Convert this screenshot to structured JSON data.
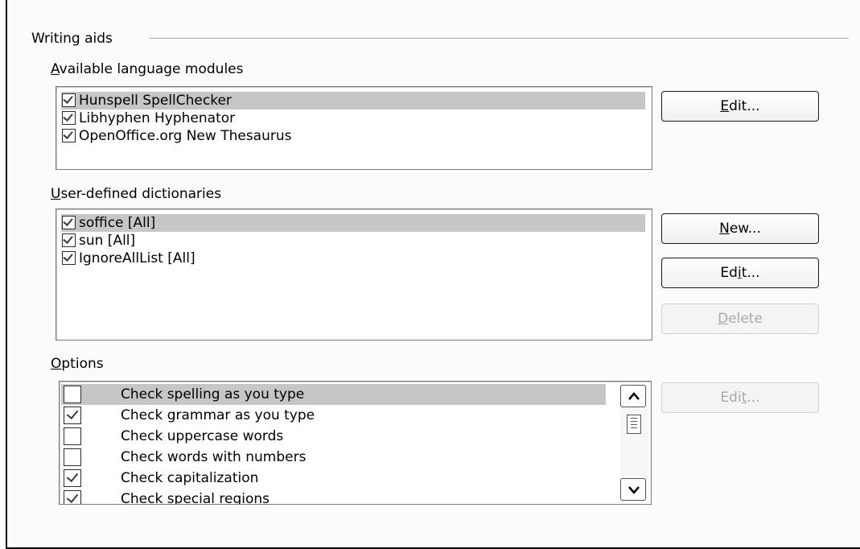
{
  "group": {
    "title": "Writing aids"
  },
  "modules": {
    "label": "Available language modules",
    "items": [
      {
        "label": "Hunspell SpellChecker",
        "checked": true,
        "selected": true
      },
      {
        "label": "Libhyphen Hyphenator",
        "checked": true,
        "selected": false
      },
      {
        "label": "OpenOffice.org New Thesaurus",
        "checked": true,
        "selected": false
      }
    ],
    "edit_label": "Edit..."
  },
  "dictionaries": {
    "label": "User-defined dictionaries",
    "items": [
      {
        "label": "soffice [All]",
        "checked": true,
        "selected": true
      },
      {
        "label": "sun [All]",
        "checked": true,
        "selected": false
      },
      {
        "label": "IgnoreAllList [All]",
        "checked": true,
        "selected": false
      }
    ],
    "new_label": "New...",
    "edit_label": "Edit...",
    "delete_label": "Delete"
  },
  "options": {
    "label": "Options",
    "items": [
      {
        "label": "Check spelling as you type",
        "checked": false,
        "selected": true
      },
      {
        "label": "Check grammar as you type",
        "checked": true,
        "selected": false
      },
      {
        "label": "Check uppercase words",
        "checked": false,
        "selected": false
      },
      {
        "label": "Check words with numbers",
        "checked": false,
        "selected": false
      },
      {
        "label": "Check capitalization",
        "checked": true,
        "selected": false
      },
      {
        "label": "Check special regions",
        "checked": true,
        "selected": false
      }
    ],
    "edit_label": "Edit..."
  }
}
